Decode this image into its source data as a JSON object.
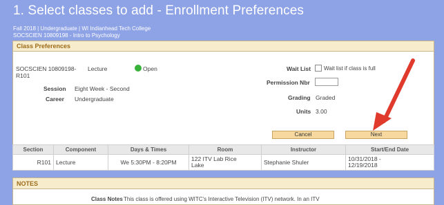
{
  "page": {
    "title": "1.  Select classes to add - Enrollment Preferences",
    "term_line": "Fall 2018 | Undergraduate | WI Indianhead Tech College",
    "course_line": "SOCSCIEN 10809198 - Intro to Psychology"
  },
  "class_prefs": {
    "header": "Class Preferences",
    "class_id_line1": "SOCSCIEN 10809198-",
    "class_id_line2": "R101",
    "component": "Lecture",
    "status": "Open",
    "session_label": "Session",
    "session_value": "Eight Week - Second",
    "career_label": "Career",
    "career_value": "Undergraduate",
    "waitlist_label": "Wait List",
    "waitlist_option": "Wait list if class is full",
    "permission_label": "Permission Nbr",
    "permission_value": "",
    "grading_label": "Grading",
    "grading_value": "Graded",
    "units_label": "Units",
    "units_value": "3.00",
    "cancel_label": "Cancel",
    "next_label": "Next"
  },
  "sections_table": {
    "headers": [
      "Section",
      "Component",
      "Days & Times",
      "Room",
      "Instructor",
      "Start/End Date"
    ],
    "row": {
      "section": "R101",
      "component": "Lecture",
      "days_times": "We 5:30PM - 8:20PM",
      "room_line1": "122 ITV Lab Rice",
      "room_line2": "Lake",
      "instructor": "Stephanie Shuler",
      "dates_line1": "10/31/2018 -",
      "dates_line2": "12/19/2018"
    }
  },
  "notes": {
    "header": "NOTES",
    "class_notes_label": "Class Notes",
    "class_notes_text": "This class is offered using WITC's Interactive Television (ITV) network.  In an ITV"
  },
  "colors": {
    "background": "#8ea2e6",
    "section_header": "#f7edcd",
    "button": "#f7d9a0",
    "open_status": "#38b238",
    "annotation_arrow": "#e03a2c"
  }
}
